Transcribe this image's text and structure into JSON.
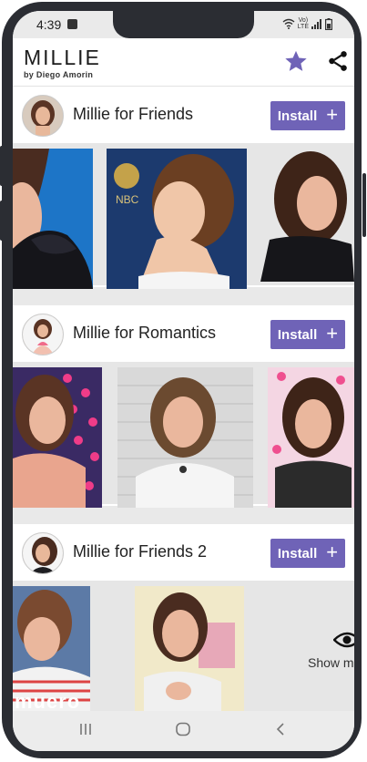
{
  "status": {
    "time": "4:39",
    "network": "LTE",
    "net_sub": "Vo)"
  },
  "app": {
    "title": "MILLIE",
    "subtitle": "by Diego Amorin"
  },
  "packs": [
    {
      "title": "Millie for Friends",
      "install_label": "Install"
    },
    {
      "title": "Millie for Romantics",
      "install_label": "Install"
    },
    {
      "title": "Millie for Friends 2",
      "install_label": "Install"
    }
  ],
  "show_more_label": "Show m",
  "sticker_caption": "muero",
  "colors": {
    "accent": "#6f63b7",
    "frame": "#2b2d33",
    "bg": "#e9e9e9"
  },
  "icons": {
    "favorite": "star-icon",
    "share": "share-icon",
    "more": "eye-icon"
  }
}
